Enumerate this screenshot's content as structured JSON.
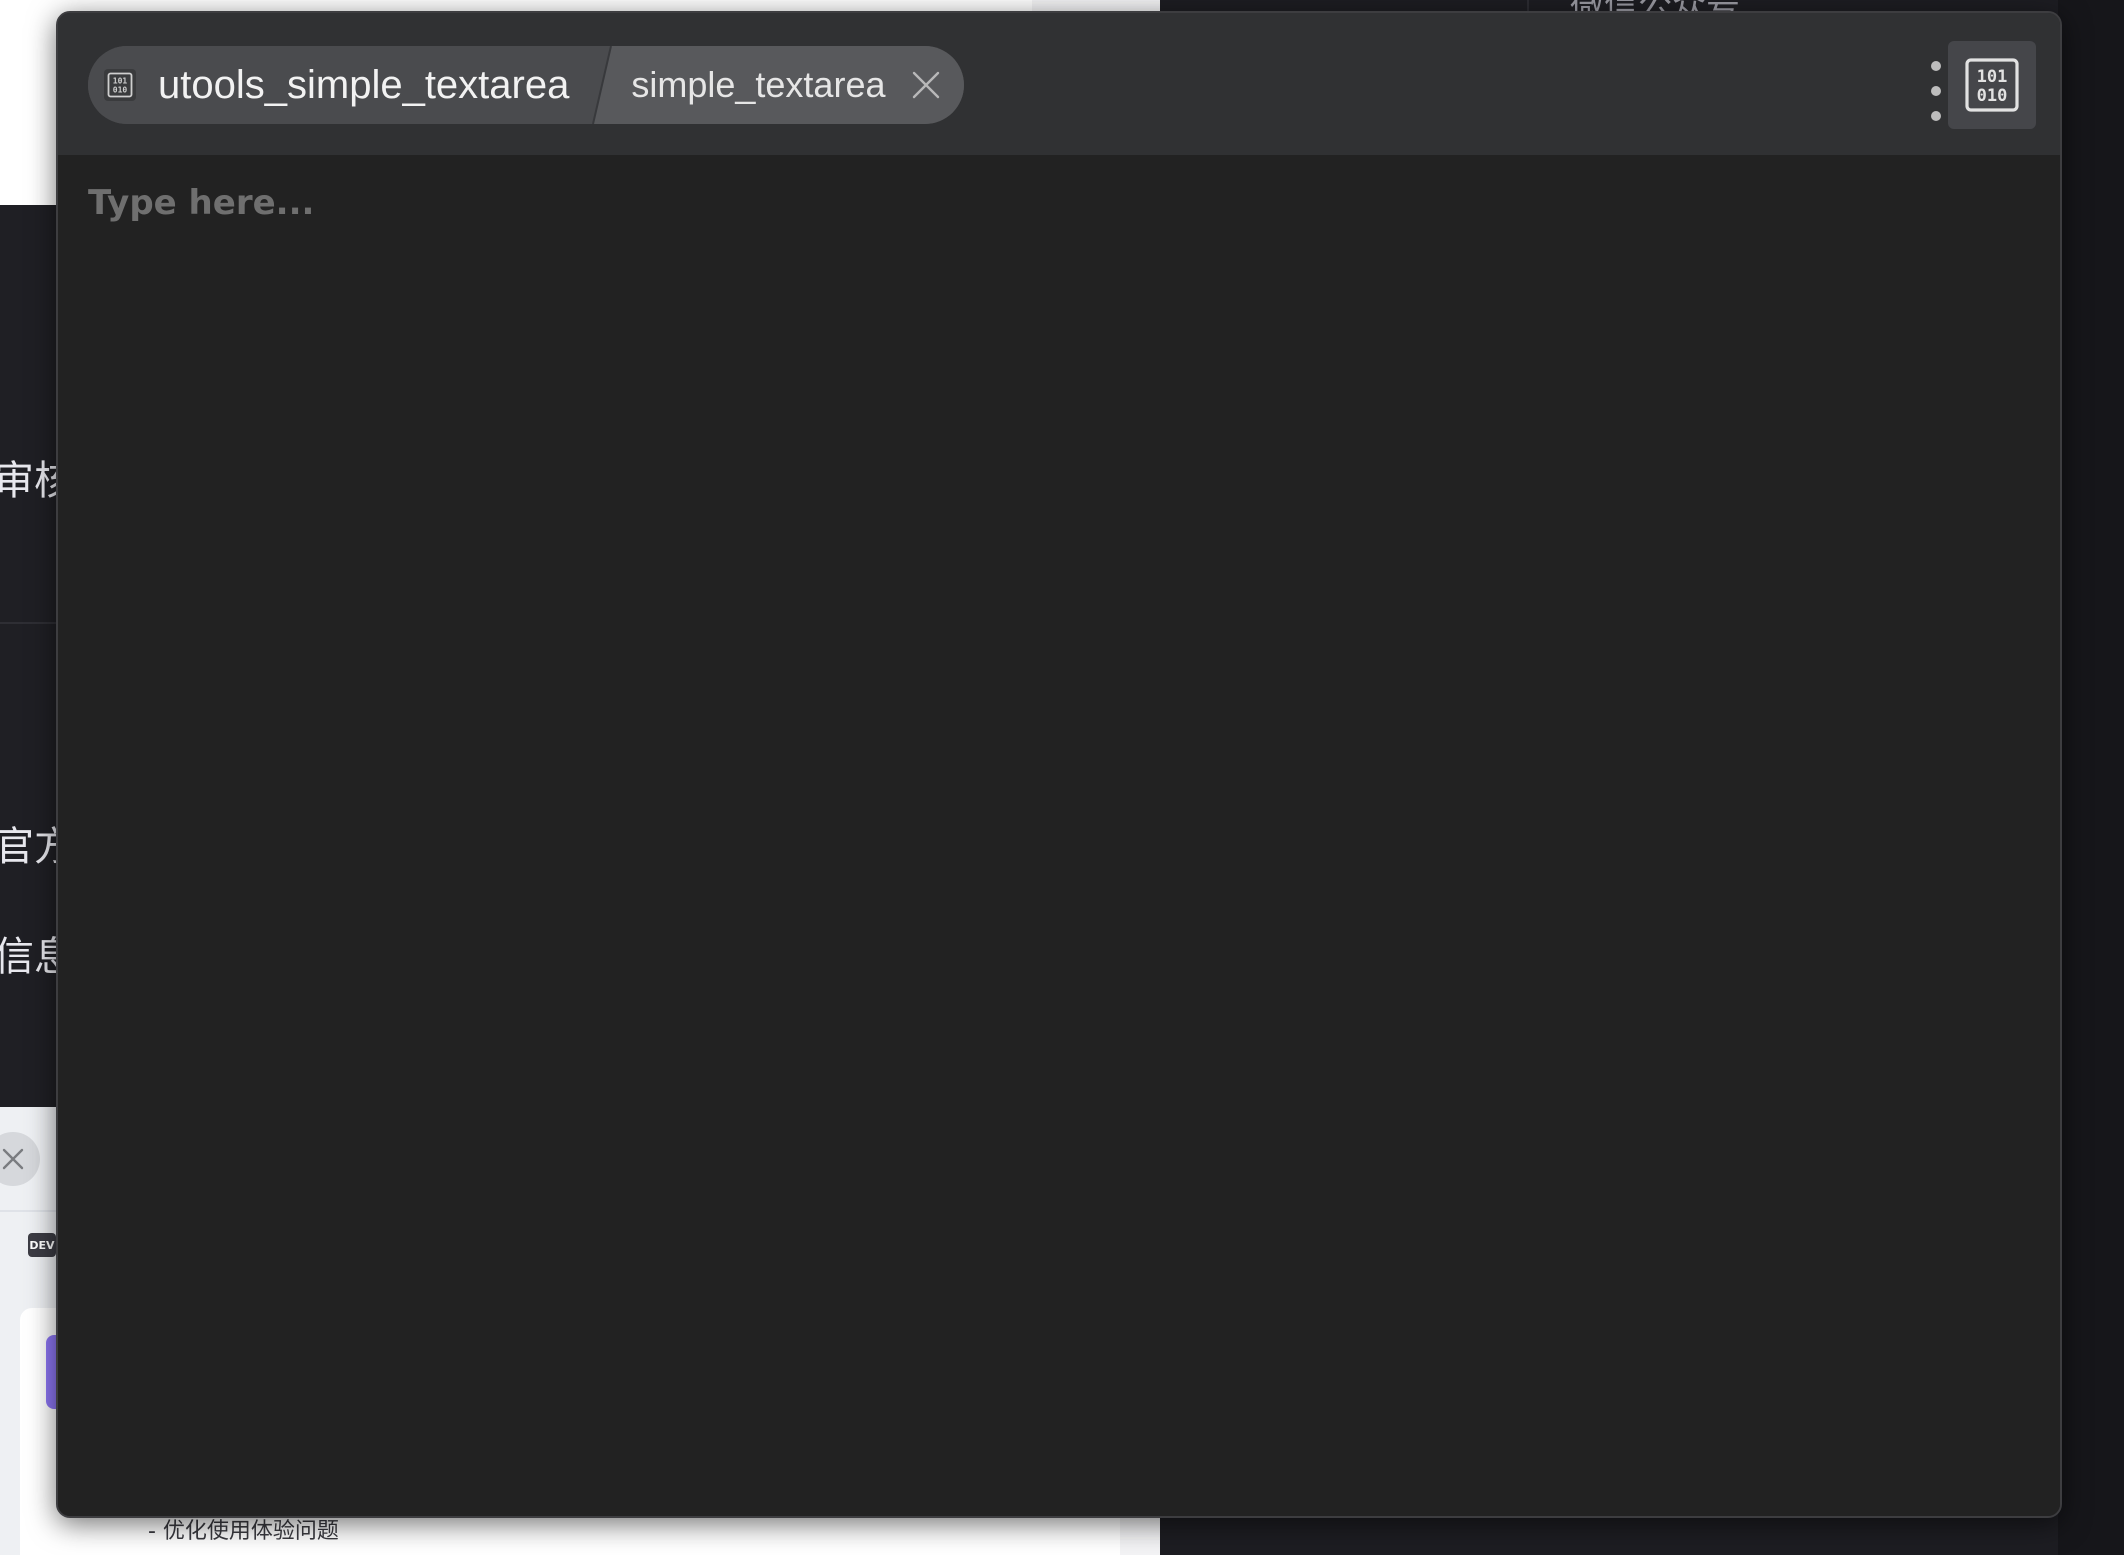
{
  "window": {
    "plugin_name": "utools_simple_textarea",
    "feature_name": "simple_textarea"
  },
  "editor": {
    "placeholder": "Type here...",
    "value": ""
  },
  "icons": {
    "plugin": "binary-code-icon",
    "close": "close-icon",
    "more": "more-vertical-icon"
  },
  "background": {
    "right_top_text": "微信公众号",
    "side_labels": [
      "审核通",
      "官方",
      "信息"
    ],
    "dev_badge": "DEV",
    "bottom_note": "- 优化使用体验问题"
  }
}
